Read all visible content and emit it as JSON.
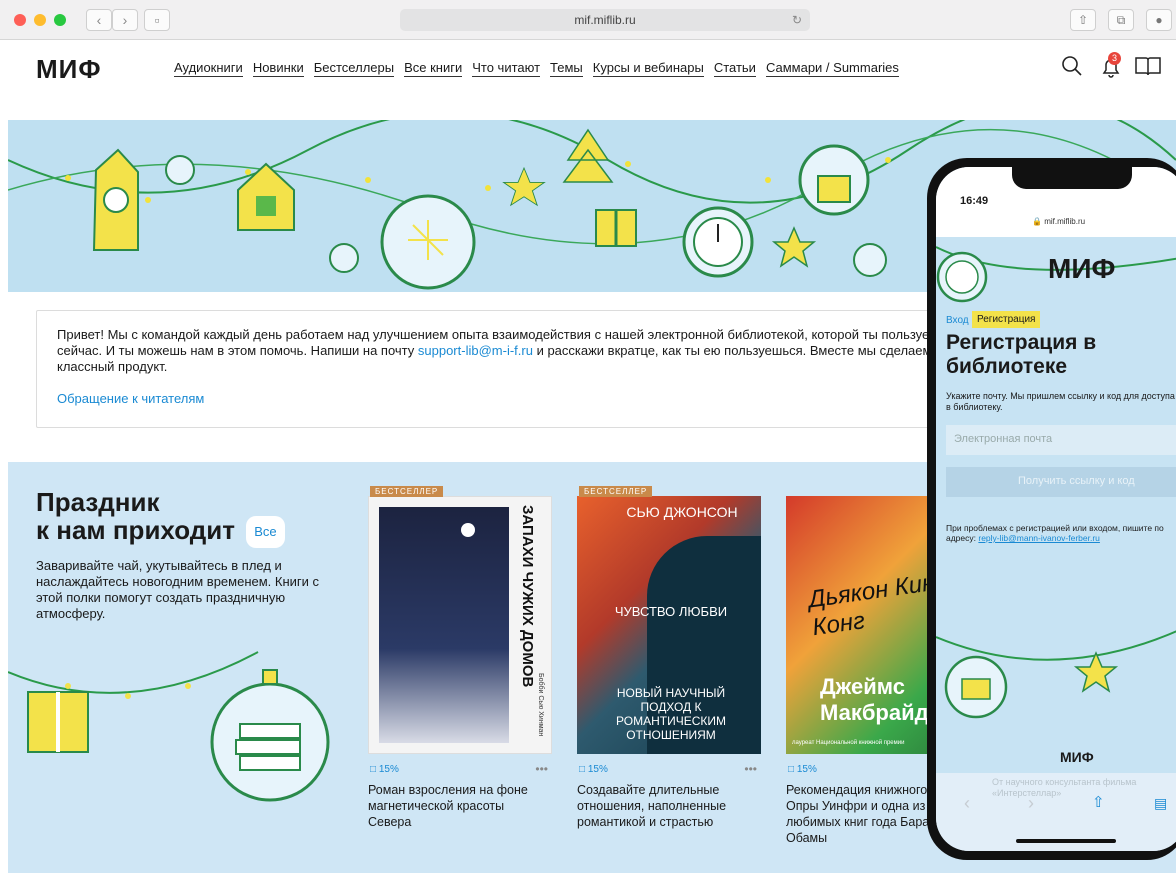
{
  "browser": {
    "url": "mif.miflib.ru",
    "traffic_colors": [
      "#fe5f57",
      "#febc2e",
      "#28c840"
    ]
  },
  "header": {
    "logo": "МИФ",
    "nav": [
      "Аудиокниги",
      "Новинки",
      "Бестселлеры",
      "Все книги",
      "Что читают",
      "Темы",
      "Курсы и вебинары",
      "Статьи",
      "Саммари / Summaries"
    ],
    "notification_count": "3",
    "icons": [
      "search-icon",
      "bell-icon",
      "book-icon"
    ]
  },
  "notice": {
    "text_before": "Привет! Мы с командой каждый день работаем над улучшением опыта взаимодействия с нашей электронной библиотекой, которой ты пользуешься сейчас. И ты можешь нам в этом помочь. Напиши на почту ",
    "email": "support-lib@m-i-f.ru",
    "text_after": " и расскажи вкратце, как ты ею пользуешься. Вместе мы сделаем классный продукт.",
    "link": "Обращение к читателям"
  },
  "shelf": {
    "title_line1": "Праздник",
    "title_line2": "к нам приходит",
    "all_button": "Все",
    "description": "Заваривайте чай, укутывайтесь в плед и наслаждайтесь новогодним временем. Книги с этой полки помогут создать праздничную атмосферу.",
    "books": [
      {
        "badge": "БЕСТСЕЛЛЕР",
        "cover_title": "ЗАПАХИ ЧУЖИХ ДОМОВ",
        "cover_author": "Бобби Сью Хинман",
        "percent": "15%",
        "description": "Роман взросления на фоне магнетической красоты Севера"
      },
      {
        "badge": "БЕСТСЕЛЛЕР",
        "cover_author": "СЬЮ ДЖОНСОН",
        "cover_title": "ЧУВСТВО ЛЮБВИ",
        "cover_sub": "НОВЫЙ НАУЧНЫЙ ПОДХОД К РОМАНТИЧЕСКИМ ОТНОШЕНИЯМ",
        "percent": "15%",
        "description": "Создавайте длительные отношения, наполненные романтикой и страстью"
      },
      {
        "badge": "",
        "cover_title": "Дьякон Кинг-Конг",
        "cover_author": "Джеймс Макбрайд",
        "cover_sub": "лауреат Национальной книжной премии",
        "percent": "15%",
        "description": "Рекомендация книжного клуба Опры Уинфри и одна из любимых книг года Барака Обамы"
      }
    ]
  },
  "phone": {
    "time": "16:49",
    "url": "mif.miflib.ru",
    "logo": "МИФ",
    "tab_login": "Вход",
    "tab_register": "Регистрация",
    "title": "Регистрация в библиотеке",
    "hint": "Укажите почту. Мы пришлем ссылку и код для доступа в библиотеку.",
    "email_placeholder": "Электронная почта",
    "submit": "Получить ссылку и код",
    "help_text": "При проблемах с регистрацией или входом, пишите по адресу: ",
    "help_email": "reply-lib@mann-ivanov-ferber.ru",
    "footer_logo": "МИФ",
    "footer_text": "От научного консультанта фильма «Интерстеллар»"
  }
}
